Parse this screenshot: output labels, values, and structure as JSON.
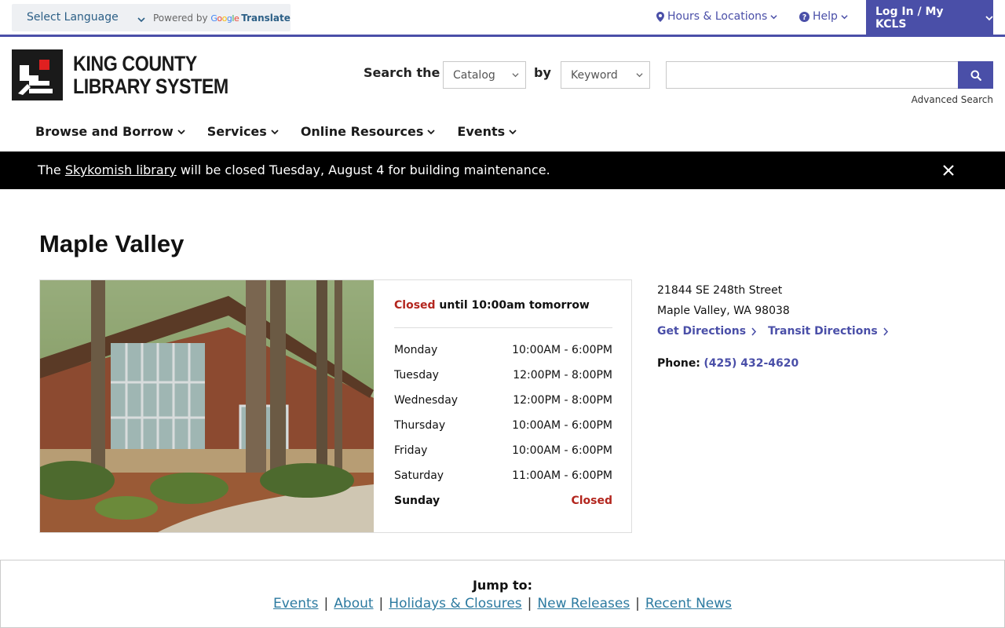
{
  "topbar": {
    "language_label": "Select Language",
    "powered_by": "Powered by",
    "google": "Google",
    "translate": "Translate",
    "hours_locations": "Hours & Locations",
    "help": "Help",
    "login": "Log In / My KCLS"
  },
  "header": {
    "logo_line1": "KING COUNTY",
    "logo_line2": "LIBRARY SYSTEM",
    "search_label": "Search the",
    "catalog_option": "Catalog",
    "by_label": "by",
    "keyword_option": "Keyword",
    "search_value": "",
    "advanced_search": "Advanced Search"
  },
  "nav": {
    "items": [
      {
        "label": "Browse and Borrow"
      },
      {
        "label": "Services"
      },
      {
        "label": "Online Resources"
      },
      {
        "label": "Events"
      }
    ]
  },
  "alert": {
    "prefix": "The",
    "link": "Skykomish library",
    "suffix": "will be closed Tuesday, August 4 for building maintenance."
  },
  "page": {
    "title": "Maple Valley",
    "status_closed": "Closed",
    "status_rest": "until 10:00am tomorrow",
    "hours": [
      {
        "day": "Monday",
        "time": "10:00AM - 6:00PM"
      },
      {
        "day": "Tuesday",
        "time": "12:00PM - 8:00PM"
      },
      {
        "day": "Wednesday",
        "time": "12:00PM - 8:00PM"
      },
      {
        "day": "Thursday",
        "time": "10:00AM - 6:00PM"
      },
      {
        "day": "Friday",
        "time": "10:00AM - 6:00PM"
      },
      {
        "day": "Saturday",
        "time": "11:00AM - 6:00PM"
      },
      {
        "day": "Sunday",
        "time": "Closed"
      }
    ],
    "address_line1": "21844 SE 248th Street",
    "address_line2": "Maple Valley, WA 98038",
    "get_directions": "Get Directions",
    "transit_directions": "Transit Directions",
    "phone_label": "Phone:",
    "phone_number": "(425) 432-4620"
  },
  "jump": {
    "title": "Jump to:",
    "links": [
      "Events",
      "About",
      "Holidays & Closures",
      "New Releases",
      "Recent News"
    ]
  },
  "colors": {
    "brand": "#4a4fa8",
    "closed_red": "#b3261e",
    "link_teal": "#2c7aa0"
  }
}
